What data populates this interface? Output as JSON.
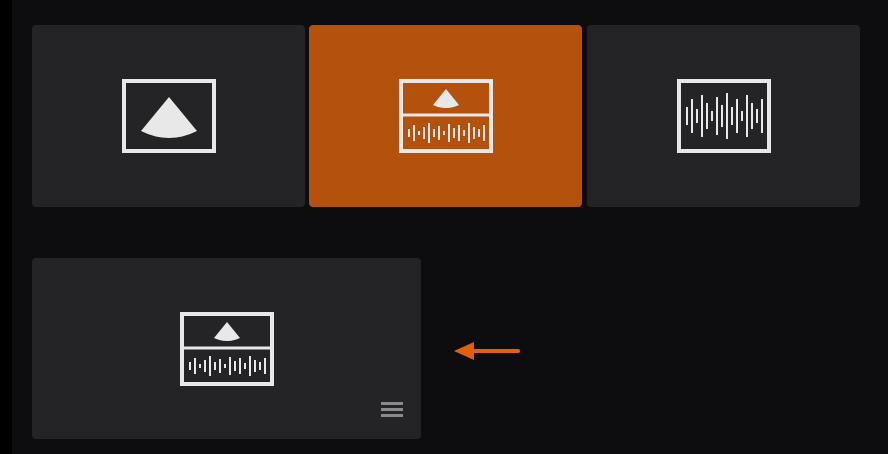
{
  "modes": [
    {
      "id": "2d",
      "icon": "b-mode-sector-icon",
      "active": false
    },
    {
      "id": "bm",
      "icon": "b-mode-m-mode-split-icon",
      "active": true
    },
    {
      "id": "m",
      "icon": "m-mode-waveform-icon",
      "active": false
    }
  ],
  "preview": {
    "icon": "b-mode-m-mode-split-icon",
    "menu_icon": "hamburger-menu-icon"
  },
  "annotation": {
    "icon": "arrow-left-icon",
    "color": "#e0600f"
  },
  "colors": {
    "background": "#0d0d0f",
    "button": "#242427",
    "active": "#b4510c",
    "icon": "#e8e8e8"
  }
}
